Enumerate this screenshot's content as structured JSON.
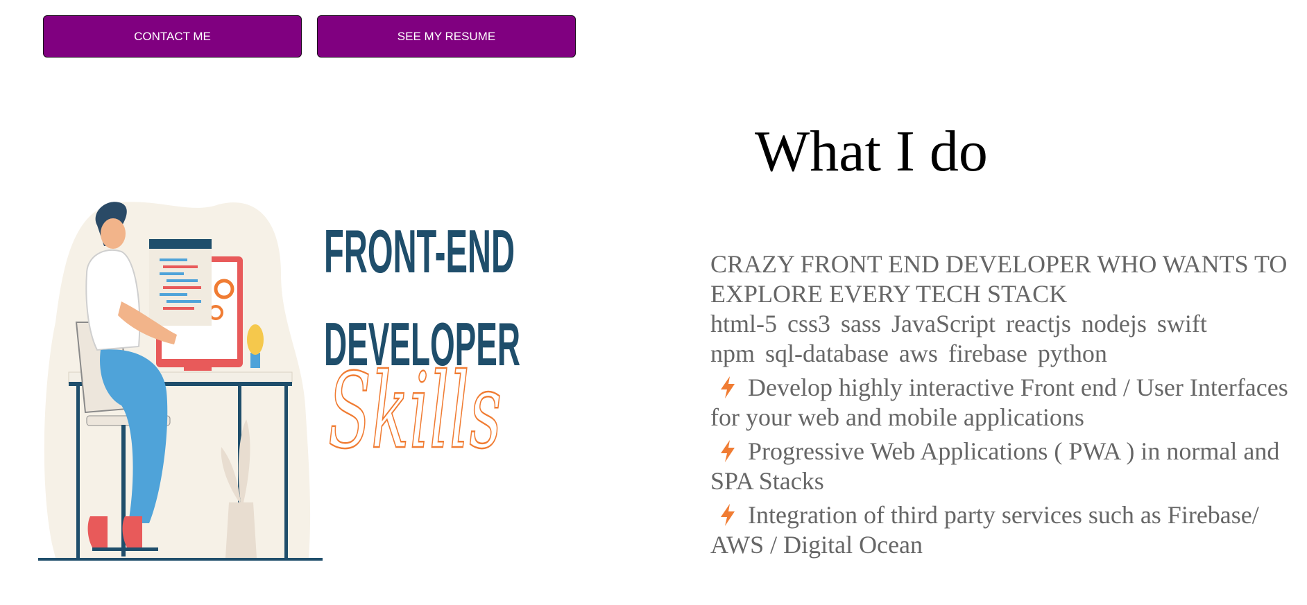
{
  "buttons": {
    "contact_label": "CONTACT ME",
    "resume_label": "SEE MY RESUME",
    "color": "#800080"
  },
  "illustration": {
    "line1": "FRONT-END",
    "line2": "DEVELOPER",
    "script": "Skills",
    "navy": "#1f4e6b",
    "orange": "#f07c33"
  },
  "section": {
    "title": "What I do",
    "subtitle": "CRAZY FRONT END DEVELOPER WHO WANTS TO EXPLORE EVERY TECH STACK",
    "skills_line1": "html-5  css3  sass JavaScript reactjs nodejs swift",
    "skills_line2": "npm  sql-database aws  firebase python",
    "features": [
      {
        "icon": "lightning-icon",
        "text": "Develop highly interactive Front end / User Interfaces for your web and mobile applications"
      },
      {
        "icon": "lightning-icon",
        "text": "Progressive Web Applications ( PWA ) in normal and SPA Stacks"
      },
      {
        "icon": "lightning-icon",
        "text": "Integration of third party services such as Firebase/ AWS / Digital Ocean"
      }
    ]
  }
}
